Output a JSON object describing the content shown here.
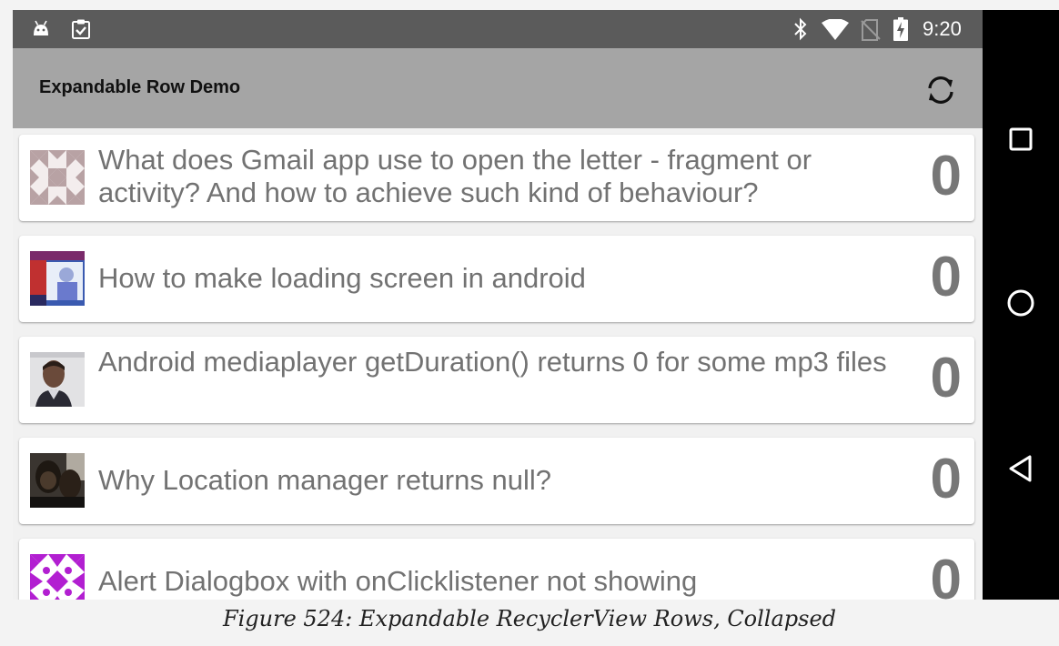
{
  "status_bar": {
    "time": "9:20",
    "icons": [
      "android-icon",
      "clipboard-check-icon",
      "bluetooth-icon",
      "wifi-icon",
      "no-sim-icon",
      "battery-charging-icon"
    ]
  },
  "toolbar": {
    "title": "Expandable Row Demo",
    "refresh_icon": "refresh-icon"
  },
  "questions": [
    {
      "title": "What does Gmail app use to open the letter - fragment or activity? And how to achieve such kind of behaviour?",
      "score": "0",
      "avatar": "geometric-pattern-avatar"
    },
    {
      "title": "How to make loading screen in android",
      "score": "0",
      "avatar": "photo-avatar"
    },
    {
      "title": "Android mediaplayer getDuration() returns 0 for some mp3 files",
      "score": "0",
      "avatar": "person-photo-avatar"
    },
    {
      "title": "Why Location manager returns null?",
      "score": "0",
      "avatar": "people-photo-avatar"
    },
    {
      "title": "Alert Dialogbox with onClicklistener not showing",
      "score": "0",
      "avatar": "purple-pattern-avatar"
    }
  ],
  "nav_bar": [
    "recents-icon",
    "home-icon",
    "back-icon"
  ],
  "caption": "Figure 524: Expandable RecyclerView Rows, Collapsed",
  "colors": {
    "status_bar": "#5b5b5b",
    "toolbar": "#a5a5a5",
    "background": "#f1f1f1",
    "text": "#727272",
    "accent_purple": "#b21fd1"
  }
}
